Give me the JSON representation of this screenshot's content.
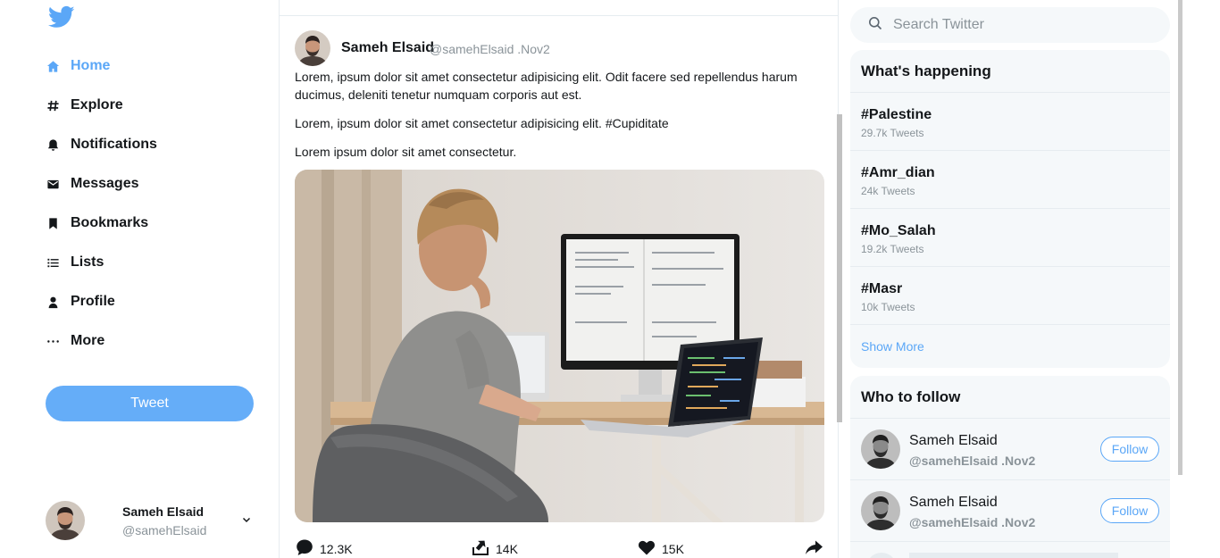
{
  "colors": {
    "accent": "#5ba7f7",
    "tweet_button": "#65adf8",
    "panel_bg": "#f5f8fa",
    "muted": "#8a9399"
  },
  "sidebar": {
    "logo_icon": "twitter-bird-icon",
    "items": [
      {
        "label": "Home",
        "icon": "home-icon",
        "active": true
      },
      {
        "label": "Explore",
        "icon": "hashtag-icon"
      },
      {
        "label": "Notifications",
        "icon": "bell-icon"
      },
      {
        "label": "Messages",
        "icon": "envelope-icon"
      },
      {
        "label": "Bookmarks",
        "icon": "bookmark-icon"
      },
      {
        "label": "Lists",
        "icon": "list-icon"
      },
      {
        "label": "Profile",
        "icon": "user-icon"
      },
      {
        "label": "More",
        "icon": "ellipsis-icon"
      }
    ],
    "tweet_button": "Tweet",
    "profile": {
      "name": "Sameh Elsaid",
      "handle": "@samehElsaid"
    }
  },
  "tweet": {
    "author": "Sameh Elsaid",
    "handle_date": "@samehElsaid .Nov2",
    "paragraphs": [
      "Lorem, ipsum dolor sit amet consectetur adipisicing elit. Odit facere sed repellendus harum ducimus, deleniti tenetur numquam corporis aut est.",
      "Lorem, ipsum dolor sit amet consectetur adipisicing elit. #Cupiditate",
      "Lorem ipsum dolor sit amet consectetur."
    ],
    "actions": {
      "replies": "12.3K",
      "retweets": "14K",
      "likes": "15K"
    }
  },
  "right": {
    "search_placeholder": "Search Twitter",
    "trends_title": "What's happening",
    "trends": [
      {
        "tag": "#Palestine",
        "count": "29.7k Tweets"
      },
      {
        "tag": "#Amr_dian",
        "count": "24k Tweets"
      },
      {
        "tag": "#Mo_Salah",
        "count": "19.2k Tweets"
      },
      {
        "tag": "#Masr",
        "count": "10k Tweets"
      }
    ],
    "show_more": "Show More",
    "follow_title": "Who to follow",
    "follow": [
      {
        "name": "Sameh Elsaid",
        "handle": "@samehElsaid .Nov2",
        "button": "Follow"
      },
      {
        "name": "Sameh Elsaid",
        "handle": "@samehElsaid .Nov2",
        "button": "Follow"
      }
    ]
  }
}
